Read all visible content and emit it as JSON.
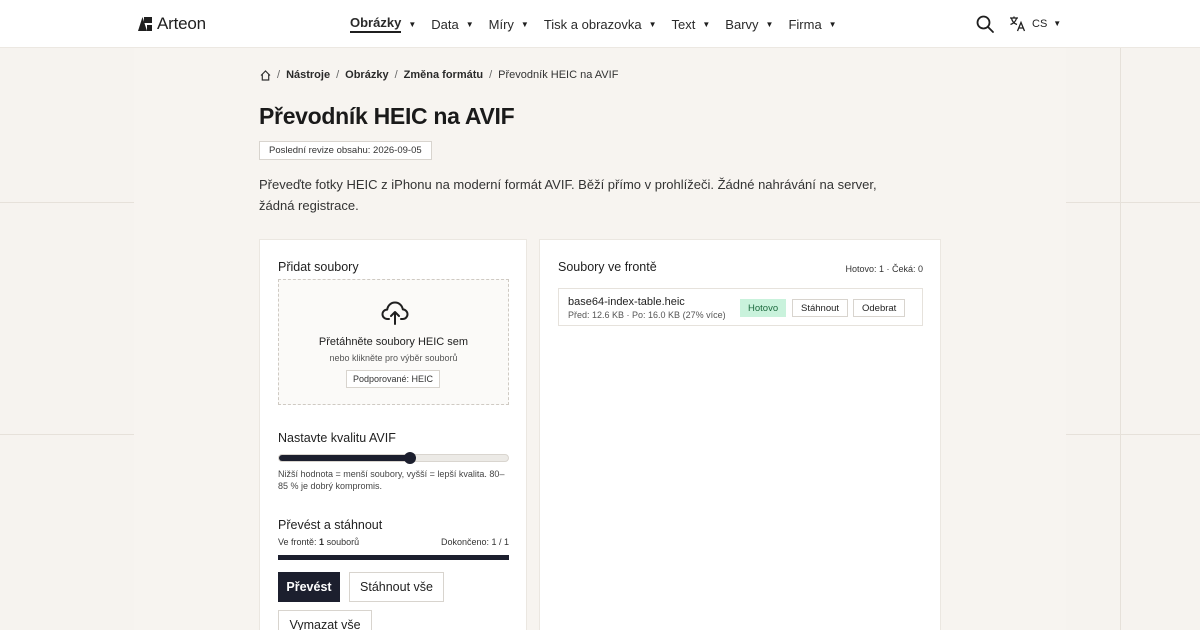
{
  "header": {
    "logo_text": "Arteon",
    "nav": [
      {
        "label": "Obrázky",
        "active": true
      },
      {
        "label": "Data",
        "active": false
      },
      {
        "label": "Míry",
        "active": false
      },
      {
        "label": "Tisk a obrazovka",
        "active": false
      },
      {
        "label": "Text",
        "active": false
      },
      {
        "label": "Barvy",
        "active": false
      },
      {
        "label": "Firma",
        "active": false
      }
    ],
    "language": "CS",
    "icons": {
      "search": "search-icon",
      "translate": "translate-icon",
      "home": "home-icon"
    }
  },
  "breadcrumb": {
    "items": [
      "Nástroje",
      "Obrázky",
      "Změna formátu"
    ],
    "current": "Převodník HEIC na AVIF"
  },
  "page": {
    "title": "Převodník HEIC na AVIF",
    "revision": "Poslední revize obsahu: 2026-09-05",
    "intro": "Převeďte fotky HEIC z iPhonu na moderní formát AVIF. Běží přímo v prohlížeči. Žádné nahrávání na server, žádná registrace."
  },
  "upload": {
    "title": "Přidat soubory",
    "drop_title": "Přetáhněte soubory HEIC sem",
    "drop_sub": "nebo klikněte pro výběr souborů",
    "supported": "Podporované: HEIC"
  },
  "quality": {
    "title": "Nastavte kvalitu AVIF",
    "value_fraction": 0.57,
    "hint": "Nižší hodnota = menší soubory, vyšší = lepší kvalita. 80–85 % je dobrý kompromis."
  },
  "convert": {
    "title": "Převést a stáhnout",
    "queue_prefix": "Ve frontě:",
    "queue_count": "1",
    "queue_suffix": "souborů",
    "done": "Dokončeno: 1 / 1",
    "progress_fraction": 1.0,
    "convert_btn": "Převést",
    "download_all_btn": "Stáhnout vše",
    "clear_btn": "Vymazat vše"
  },
  "queue": {
    "title": "Soubory ve frontě",
    "counts": "Hotovo: 1 · Čeká: 0",
    "files": [
      {
        "name": "base64-index-table.heic",
        "meta": "Před: 12.6 KB · Po: 16.0 KB (27% více)",
        "status": "Hotovo",
        "download": "Stáhnout",
        "remove": "Odebrat"
      }
    ]
  },
  "colors": {
    "accent": "#1c1f2e",
    "success_bg": "#c9f2dc",
    "success_text": "#1d6b3f"
  }
}
